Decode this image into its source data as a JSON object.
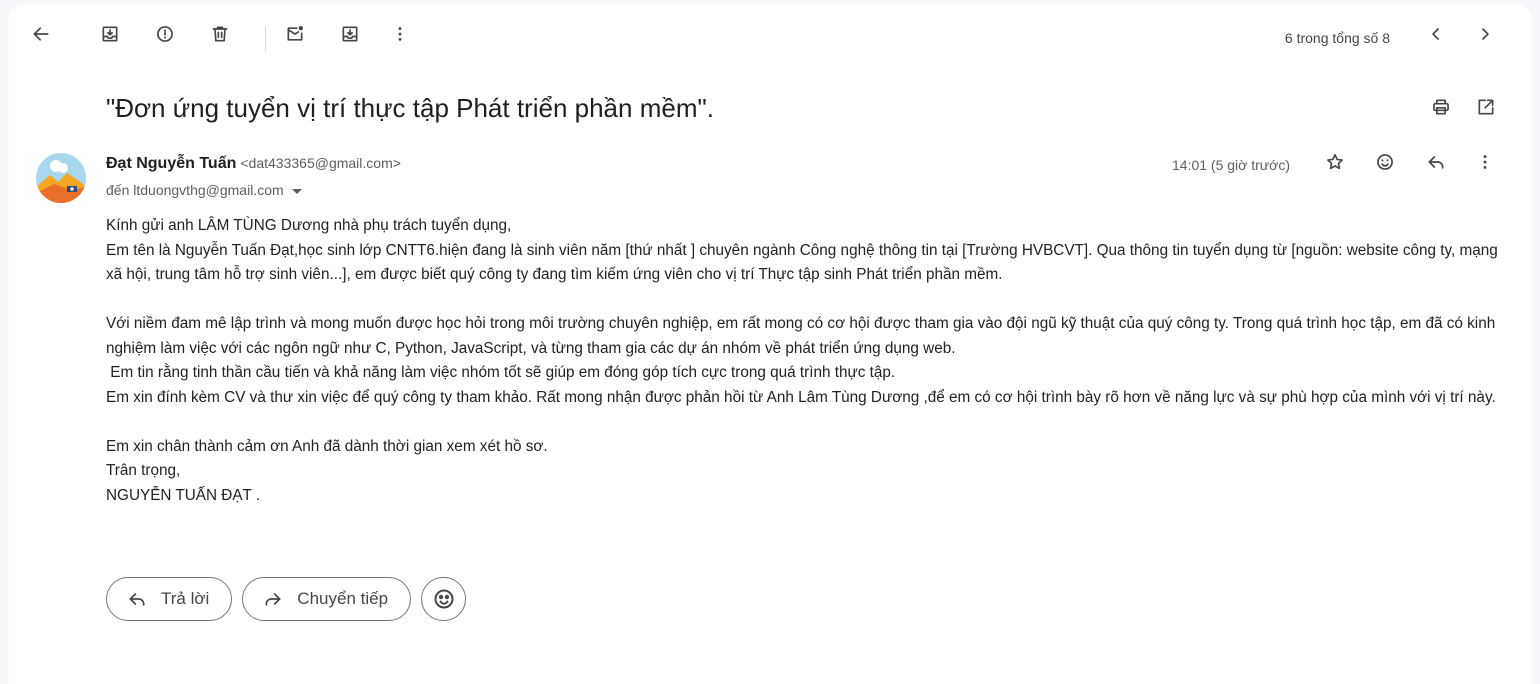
{
  "toolbar": {
    "pager_text": "6 trong tổng số 8"
  },
  "subject": "\"Đơn ứng tuyển vị trí thực tập Phát triển phần mềm\".",
  "sender": {
    "name": "Đạt Nguyễn Tuấn",
    "email": "<dat433365@gmail.com>",
    "to": "đến ltduongvthg@gmail.com",
    "time": "14:01 (5 giờ trước)"
  },
  "body": {
    "lines": [
      "Kính gửi anh LÂM TÙNG Dương nhà phụ trách tuyển dụng,",
      "Em tên là Nguyễn Tuấn Đạt,học sinh lớp CNTT6.hiện đang là sinh viên năm [thứ nhất ] chuyên ngành Công nghệ thông tin tại [Trường HVBCVT]. Qua thông tin tuyển dụng từ [nguồn: website công ty, mạng xã hội, trung tâm hỗ trợ sinh viên...], em được biết quý công ty đang tìm kiếm ứng viên cho vị trí Thực tập sinh Phát triển phần mềm.",
      "",
      "Với niềm đam mê lập trình và mong muốn được học hỏi trong môi trường chuyên nghiệp, em rất mong có cơ hội được tham gia vào đội ngũ kỹ thuật của quý công ty. Trong quá trình học tập, em đã có kinh nghiệm làm việc với các ngôn ngữ như C, Python, JavaScript, và từng tham gia các dự án nhóm về phát triển ứng dụng web.",
      " Em tin rằng tinh thần cầu tiến và khả năng làm việc nhóm tốt sẽ giúp em đóng góp tích cực trong quá trình thực tập.",
      "Em xin đính kèm CV và thư xin việc để quý công ty tham khảo. Rất mong nhận được phản hồi từ Anh Lâm Tùng Dương ,để em có cơ hội trình bày rõ hơn về năng lực và sự phù hợp của mình với vị trí này.",
      "",
      "Em xin chân thành cảm ơn Anh đã dành thời gian xem xét hồ sơ.",
      "Trân trọng,",
      "NGUYỄN TUẤN ĐẠT ."
    ]
  },
  "actions": {
    "reply_label": "Trả lời",
    "forward_label": "Chuyển tiếp"
  },
  "icons": {
    "back": "arrow-left-icon",
    "archive": "archive-icon",
    "spam": "report-spam-icon",
    "delete": "trash-icon",
    "unread": "mark-unread-icon",
    "snooze": "move-to-inbox-icon",
    "more": "more-vert-icon",
    "prev": "chevron-left-icon",
    "next": "chevron-right-icon",
    "print": "print-icon",
    "open_new": "open-in-new-icon",
    "star": "star-icon",
    "emoji": "emoji-icon",
    "reply": "reply-icon"
  },
  "colors": {
    "background": "#f6f8fc",
    "card": "#ffffff",
    "icon": "#444746",
    "text": "#1f1f1f",
    "muted": "#5e5e5e"
  }
}
